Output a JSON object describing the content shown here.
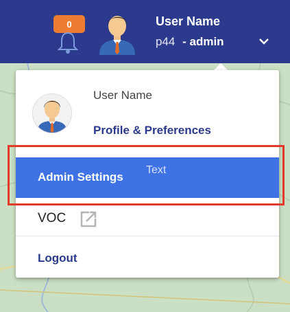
{
  "header": {
    "notification_count": "0",
    "user_name": "User Name",
    "user_id": "p44",
    "role": "- admin"
  },
  "menu": {
    "user_name": "User Name",
    "profile_link": "Profile & Preferences",
    "admin_settings": "Admin Settings",
    "text_overlay": "Text",
    "voc": "VOC",
    "logout": "Logout"
  },
  "icons": {
    "bell": "bell-icon",
    "avatar": "user-avatar-icon",
    "caret": "chevron-down-icon",
    "external": "external-link-icon"
  },
  "colors": {
    "header_bg": "#2b3a8c",
    "badge": "#ee7d34",
    "active_item": "#3f72e4",
    "highlight_border": "#e23b2a"
  }
}
